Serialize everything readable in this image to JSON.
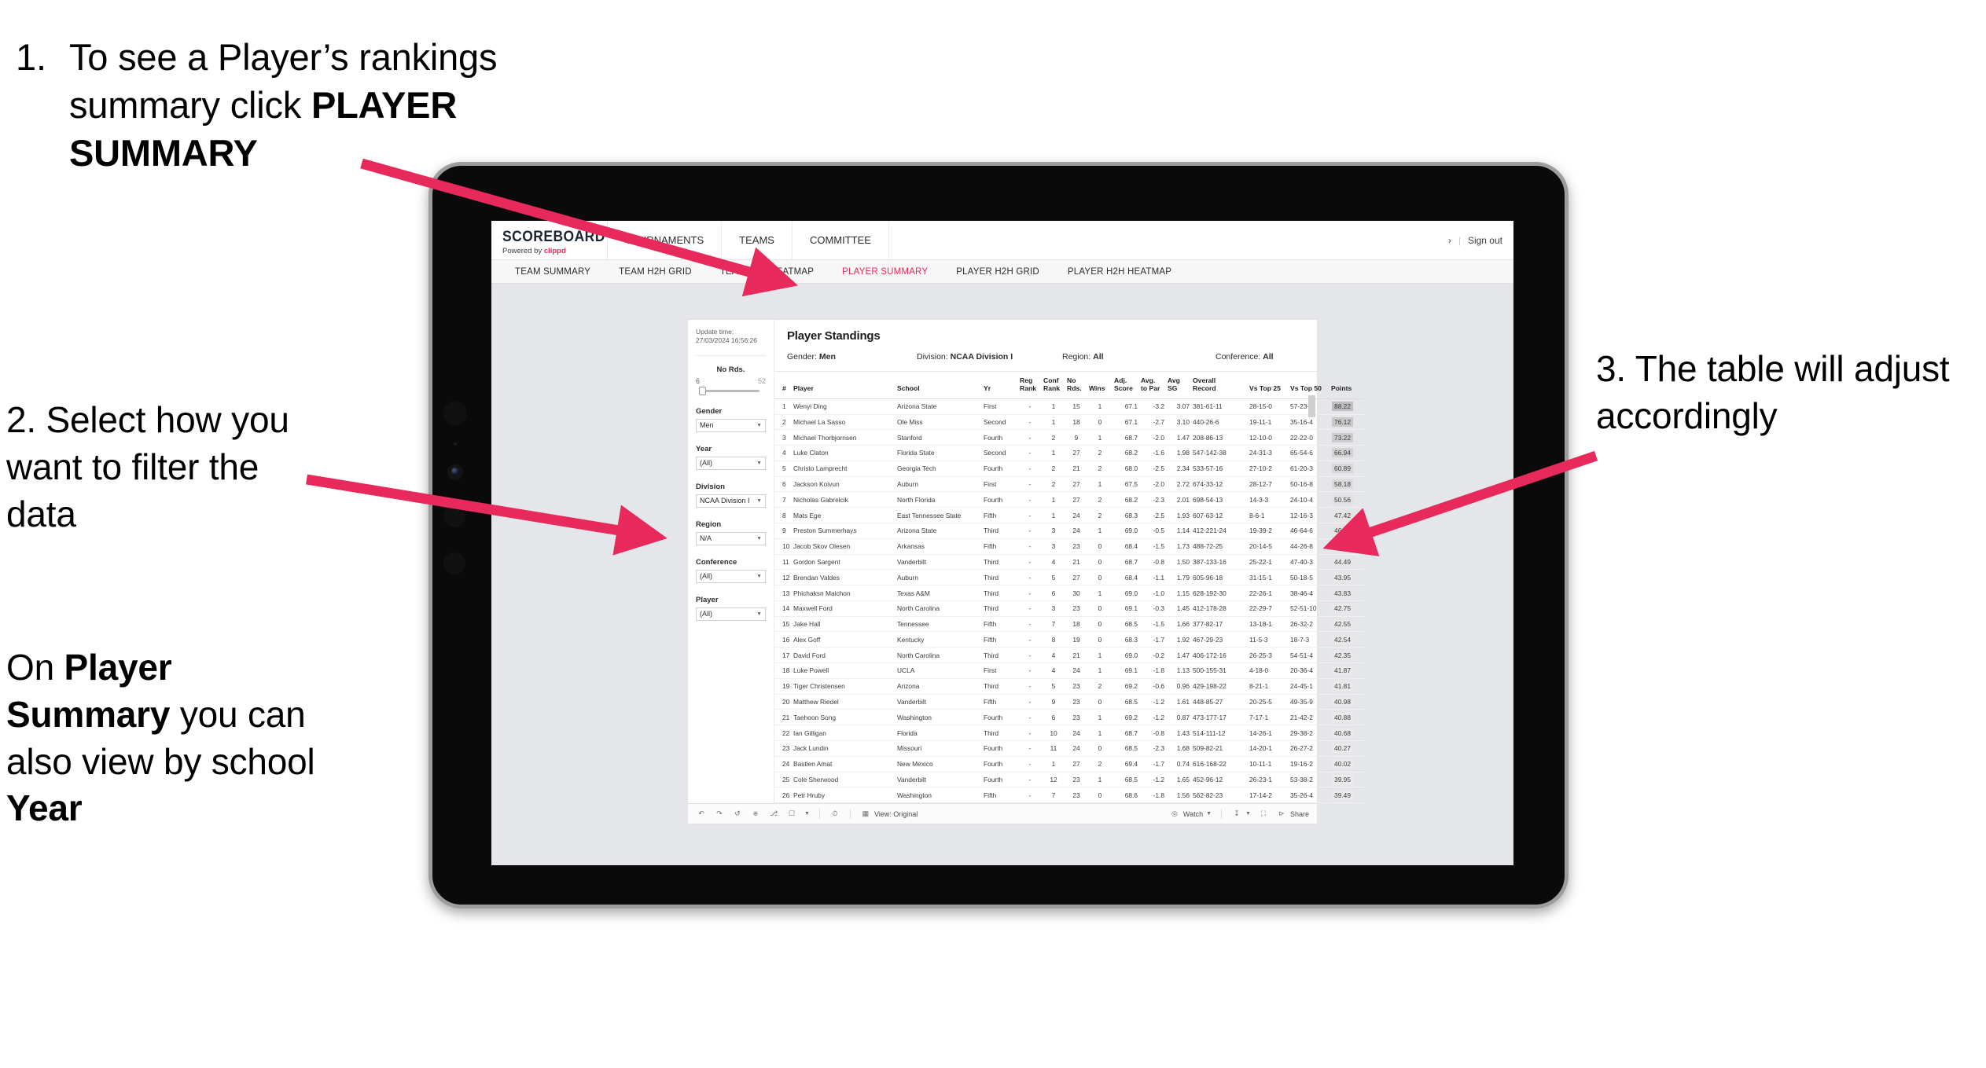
{
  "annotations": {
    "step1": {
      "number": "1.",
      "text_before": "To see a Player’s rankings summary click ",
      "text_bold": "PLAYER SUMMARY"
    },
    "step2": {
      "text": "2. Select how you want to filter the data"
    },
    "step2b": {
      "prefix": "On ",
      "bold1": "Player Summary",
      "middle": " you can also view by school ",
      "bold2": "Year"
    },
    "step3": {
      "text": "3. The table will adjust accordingly"
    },
    "arrow_color": "#e8295b"
  },
  "app": {
    "brand": {
      "title": "SCOREBOARD",
      "powered_prefix": "Powered by ",
      "powered_brand": "clippd"
    },
    "topnav": [
      {
        "label": "TOURNAMENTS"
      },
      {
        "label": "TEAMS"
      },
      {
        "label": "COMMITTEE"
      }
    ],
    "header_right": {
      "user_glyph": "›",
      "divider": "|",
      "signout": "Sign out"
    },
    "subnav": [
      {
        "label": "TEAM SUMMARY",
        "active": false
      },
      {
        "label": "TEAM H2H GRID",
        "active": false
      },
      {
        "label": "TEAM H2H HEATMAP",
        "active": false
      },
      {
        "label": "PLAYER SUMMARY",
        "active": true
      },
      {
        "label": "PLAYER H2H GRID",
        "active": false
      },
      {
        "label": "PLAYER H2H HEATMAP",
        "active": false
      }
    ],
    "accent_color": "#e8295b"
  },
  "viz": {
    "update_label": "Update time:",
    "update_value": "27/03/2024 16:56:26",
    "title": "Player Standings",
    "meta": [
      {
        "label": "Gender:",
        "value": "Men"
      },
      {
        "label": "Division:",
        "value": "NCAA Division I"
      },
      {
        "label": "Region:",
        "value": "All"
      },
      {
        "label": "Conference:",
        "value": "All"
      }
    ],
    "filters": {
      "slider": {
        "title": "No Rds.",
        "min": "6",
        "max": "52"
      },
      "dropdowns": [
        {
          "title": "Gender",
          "value": "Men"
        },
        {
          "title": "Year",
          "value": "(All)"
        },
        {
          "title": "Division",
          "value": "NCAA Division I"
        },
        {
          "title": "Region",
          "value": "N/A"
        },
        {
          "title": "Conference",
          "value": "(All)"
        },
        {
          "title": "Player",
          "value": "(All)"
        }
      ]
    },
    "toolbar": {
      "view_label": "View: Original",
      "watch_label": "Watch",
      "share_label": "Share"
    }
  },
  "chart_data": {
    "type": "table",
    "title": "Player Standings",
    "columns": [
      "#",
      "Player",
      "School",
      "Yr",
      "Reg Rank",
      "Conf Rank",
      "No Rds.",
      "Wins",
      "Adj. Score",
      "Avg. to Par",
      "Avg SG",
      "Overall Record",
      "Vs Top 25",
      "Vs Top 50",
      "Points"
    ],
    "columns_display": [
      {
        "l1": "#",
        "l2": ""
      },
      {
        "l1": "Player",
        "l2": ""
      },
      {
        "l1": "School",
        "l2": ""
      },
      {
        "l1": "Yr",
        "l2": ""
      },
      {
        "l1": "Reg",
        "l2": "Rank"
      },
      {
        "l1": "Conf",
        "l2": "Rank"
      },
      {
        "l1": "No",
        "l2": "Rds."
      },
      {
        "l1": "",
        "l2": "Wins"
      },
      {
        "l1": "Adj.",
        "l2": "Score"
      },
      {
        "l1": "Avg.",
        "l2": "to Par"
      },
      {
        "l1": "Avg",
        "l2": "SG"
      },
      {
        "l1": "Overall",
        "l2": "Record"
      },
      {
        "l1": "",
        "l2": "Vs Top 25"
      },
      {
        "l1": "",
        "l2": "Vs Top 50"
      },
      {
        "l1": "",
        "l2": "Points"
      }
    ],
    "rows": [
      [
        "1",
        "Wenyi Ding",
        "Arizona State",
        "First",
        "-",
        "1",
        "15",
        "1",
        "67.1",
        "-3.2",
        "3.07",
        "381-61-11",
        "28-15-0",
        "57-23-0",
        "88.22"
      ],
      [
        "2",
        "Michael La Sasso",
        "Ole Miss",
        "Second",
        "-",
        "1",
        "18",
        "0",
        "67.1",
        "-2.7",
        "3.10",
        "440-26-6",
        "19-11-1",
        "35-16-4",
        "76.12"
      ],
      [
        "3",
        "Michael Thorbjornsen",
        "Stanford",
        "Fourth",
        "-",
        "2",
        "9",
        "1",
        "68.7",
        "-2.0",
        "1.47",
        "208-86-13",
        "12-10-0",
        "22-22-0",
        "73.22"
      ],
      [
        "4",
        "Luke Claton",
        "Florida State",
        "Second",
        "-",
        "1",
        "27",
        "2",
        "68.2",
        "-1.6",
        "1.98",
        "547-142-38",
        "24-31-3",
        "65-54-6",
        "66.94"
      ],
      [
        "5",
        "Christo Lamprecht",
        "Georgia Tech",
        "Fourth",
        "-",
        "2",
        "21",
        "2",
        "68.0",
        "-2.5",
        "2.34",
        "533-57-16",
        "27-10-2",
        "61-20-3",
        "60.89"
      ],
      [
        "6",
        "Jackson Koivun",
        "Auburn",
        "First",
        "-",
        "2",
        "27",
        "1",
        "67.5",
        "-2.0",
        "2.72",
        "674-33-12",
        "28-12-7",
        "50-16-8",
        "58.18"
      ],
      [
        "7",
        "Nicholas Gabrelcik",
        "North Florida",
        "Fourth",
        "-",
        "1",
        "27",
        "2",
        "68.2",
        "-2.3",
        "2.01",
        "698-54-13",
        "14-3-3",
        "24-10-4",
        "50.56"
      ],
      [
        "8",
        "Mats Ege",
        "East Tennessee State",
        "Fifth",
        "-",
        "1",
        "24",
        "2",
        "68.3",
        "-2.5",
        "1.93",
        "607-63-12",
        "8-6-1",
        "12-16-3",
        "47.42"
      ],
      [
        "9",
        "Preston Summerhays",
        "Arizona State",
        "Third",
        "-",
        "3",
        "24",
        "1",
        "69.0",
        "-0.5",
        "1.14",
        "412-221-24",
        "19-39-2",
        "46-64-6",
        "46.77"
      ],
      [
        "10",
        "Jacob Skov Olesen",
        "Arkansas",
        "Fifth",
        "-",
        "3",
        "23",
        "0",
        "68.4",
        "-1.5",
        "1.73",
        "488-72-25",
        "20-14-5",
        "44-26-8",
        "44.82"
      ],
      [
        "11",
        "Gordon Sargent",
        "Vanderbilt",
        "Third",
        "-",
        "4",
        "21",
        "0",
        "68.7",
        "-0.8",
        "1.50",
        "387-133-16",
        "25-22-1",
        "47-40-3",
        "44.49"
      ],
      [
        "12",
        "Brendan Valdes",
        "Auburn",
        "Third",
        "-",
        "5",
        "27",
        "0",
        "68.4",
        "-1.1",
        "1.79",
        "605-96-18",
        "31-15-1",
        "50-18-5",
        "43.95"
      ],
      [
        "13",
        "Phichaksn Maichon",
        "Texas A&M",
        "Third",
        "-",
        "6",
        "30",
        "1",
        "69.0",
        "-1.0",
        "1.15",
        "628-192-30",
        "22-26-1",
        "38-46-4",
        "43.83"
      ],
      [
        "14",
        "Maxwell Ford",
        "North Carolina",
        "Third",
        "-",
        "3",
        "23",
        "0",
        "69.1",
        "-0.3",
        "1.45",
        "412-178-28",
        "22-29-7",
        "52-51-10",
        "42.75"
      ],
      [
        "15",
        "Jake Hall",
        "Tennessee",
        "Fifth",
        "-",
        "7",
        "18",
        "0",
        "68.5",
        "-1.5",
        "1.66",
        "377-82-17",
        "13-18-1",
        "26-32-2",
        "42.55"
      ],
      [
        "16",
        "Alex Goff",
        "Kentucky",
        "Fifth",
        "-",
        "8",
        "19",
        "0",
        "68.3",
        "-1.7",
        "1.92",
        "467-29-23",
        "11-5-3",
        "18-7-3",
        "42.54"
      ],
      [
        "17",
        "David Ford",
        "North Carolina",
        "Third",
        "-",
        "4",
        "21",
        "1",
        "69.0",
        "-0.2",
        "1.47",
        "406-172-16",
        "26-25-3",
        "54-51-4",
        "42.35"
      ],
      [
        "18",
        "Luke Powell",
        "UCLA",
        "First",
        "-",
        "4",
        "24",
        "1",
        "69.1",
        "-1.8",
        "1.13",
        "500-155-31",
        "4-18-0",
        "20-36-4",
        "41.87"
      ],
      [
        "19",
        "Tiger Christensen",
        "Arizona",
        "Third",
        "-",
        "5",
        "23",
        "2",
        "69.2",
        "-0.6",
        "0.96",
        "429-198-22",
        "8-21-1",
        "24-45-1",
        "41.81"
      ],
      [
        "20",
        "Matthew Riedel",
        "Vanderbilt",
        "Fifth",
        "-",
        "9",
        "23",
        "0",
        "68.5",
        "-1.2",
        "1.61",
        "448-85-27",
        "20-25-5",
        "49-35-9",
        "40.98"
      ],
      [
        "21",
        "Taehoon Song",
        "Washington",
        "Fourth",
        "-",
        "6",
        "23",
        "1",
        "69.2",
        "-1.2",
        "0.87",
        "473-177-17",
        "7-17-1",
        "21-42-2",
        "40.88"
      ],
      [
        "22",
        "Ian Gilligan",
        "Florida",
        "Third",
        "-",
        "10",
        "24",
        "1",
        "68.7",
        "-0.8",
        "1.43",
        "514-111-12",
        "14-26-1",
        "29-38-2",
        "40.68"
      ],
      [
        "23",
        "Jack Lundin",
        "Missouri",
        "Fourth",
        "-",
        "11",
        "24",
        "0",
        "68.5",
        "-2.3",
        "1.68",
        "509-82-21",
        "14-20-1",
        "26-27-2",
        "40.27"
      ],
      [
        "24",
        "Bastien Amat",
        "New Mexico",
        "Fourth",
        "-",
        "1",
        "27",
        "2",
        "69.4",
        "-1.7",
        "0.74",
        "616-168-22",
        "10-11-1",
        "19-16-2",
        "40.02"
      ],
      [
        "25",
        "Cole Sherwood",
        "Vanderbilt",
        "Fourth",
        "-",
        "12",
        "23",
        "1",
        "68.5",
        "-1.2",
        "1.65",
        "452-96-12",
        "26-23-1",
        "53-38-2",
        "39.95"
      ],
      [
        "26",
        "Petr Hruby",
        "Washington",
        "Fifth",
        "-",
        "7",
        "23",
        "0",
        "68.6",
        "-1.8",
        "1.56",
        "562-82-23",
        "17-14-2",
        "35-26-4",
        "39.49"
      ]
    ]
  }
}
